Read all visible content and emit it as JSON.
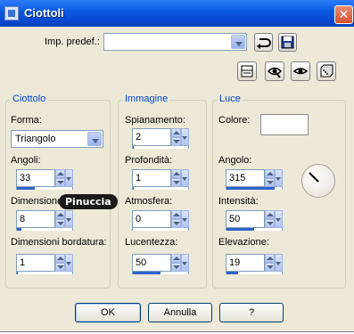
{
  "window": {
    "title": "Ciottoli",
    "close_label": "✕"
  },
  "preset": {
    "label": "Imp. predef.:",
    "value": ""
  },
  "icons": {
    "reset": "reset-icon",
    "save": "save-icon",
    "toolbar": [
      "preview-window-icon",
      "proof-icon",
      "eye-icon",
      "randomize-dice-icon"
    ]
  },
  "group_ciottolo": {
    "title": "Ciottolo",
    "forma_label": "Forma:",
    "forma_value": "Triangolo",
    "angoli_label": "Angoli:",
    "angoli_value": "33",
    "angoli_level": 0.33,
    "dimensione_label": "Dimensione",
    "dimensione_value": "8",
    "dimensione_level": 0.08,
    "bordatura_label": "Dimensioni bordatura:",
    "bordatura_value": "1",
    "bordatura_level": 0.01
  },
  "group_immagine": {
    "title": "Immagine",
    "spianamento_label": "Spianamento:",
    "spianamento_value": "2",
    "spianamento_level": 0.02,
    "profondita_label": "Profondità:",
    "profondita_value": "1",
    "profondita_level": 0.01,
    "atmosfera_label": "Atmosfera:",
    "atmosfera_value": "0",
    "atmosfera_level": 0,
    "lucentezza_label": "Lucentezza:",
    "lucentezza_value": "50",
    "lucentezza_level": 0.5
  },
  "group_luce": {
    "title": "Luce",
    "colore_label": "Colore:",
    "colore_value": "#ffffff",
    "angolo_label": "Angolo:",
    "angolo_value": "315",
    "angolo_level": 0.875,
    "intensita_label": "Intensità:",
    "intensita_value": "50",
    "intensita_level": 0.5,
    "elevazione_label": "Elevazione:",
    "elevazione_value": "19",
    "elevazione_level": 0.21
  },
  "watermark": "Pinuccia",
  "buttons": {
    "ok": "OK",
    "cancel": "Annulla",
    "help": "?"
  },
  "colors": {
    "titlebar": "#0b5ae3",
    "group_title": "#0046d5",
    "dialog_bg": "#ece9d8"
  }
}
